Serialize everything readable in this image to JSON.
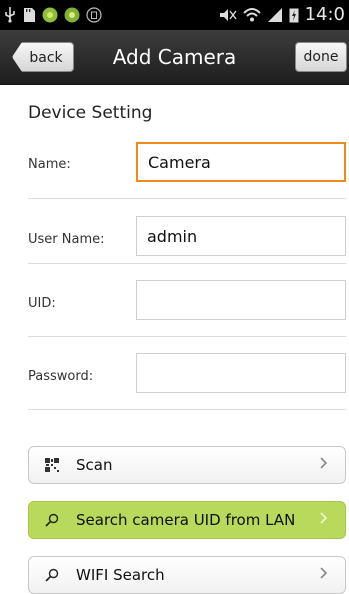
{
  "status_bar": {
    "time": "14:0"
  },
  "header": {
    "title": "Add Camera",
    "back_label": "back",
    "done_label": "done"
  },
  "form": {
    "section_title": "Device Setting",
    "name_label": "Name:",
    "name_value": "Camera",
    "username_label": "User Name:",
    "username_value": "admin",
    "uid_label": "UID:",
    "uid_value": "",
    "password_label": "Password:",
    "password_value": ""
  },
  "actions": {
    "scan_label": "Scan",
    "search_lan_label": "Search camera UID from LAN",
    "wifi_search_label": "WIFI Search"
  },
  "colors": {
    "accent_focus": "#f08a1a",
    "highlight_green": "#b8d95b"
  }
}
